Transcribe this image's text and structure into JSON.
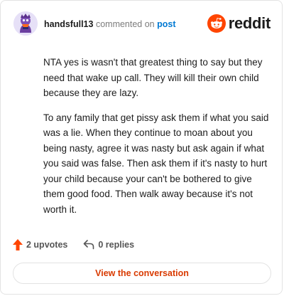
{
  "header": {
    "username": "handsfull13",
    "commented_text": "commented on",
    "post_link": "post",
    "brand_name": "reddit",
    "brand_color": "#ff4500"
  },
  "comment": {
    "paragraphs": [
      "NTA yes is wasn't that greatest thing to say but they need that wake up call. They will kill their own child because they are lazy.",
      "To any family that get pissy ask them if what you said was a lie. When they continue to moan about you being nasty, agree it was nasty but ask again if what you said was false. Then ask them if it's nasty to hurt your child because your can't be bothered to give them good food. Then walk away because it's not worth it."
    ]
  },
  "actions": {
    "upvotes_label": "2 upvotes",
    "replies_label": "0 replies",
    "upvote_icon": "upvote-arrow-icon",
    "reply_icon": "reply-arrow-icon"
  },
  "cta": {
    "label": "View the conversation",
    "color": "#d93a00"
  }
}
